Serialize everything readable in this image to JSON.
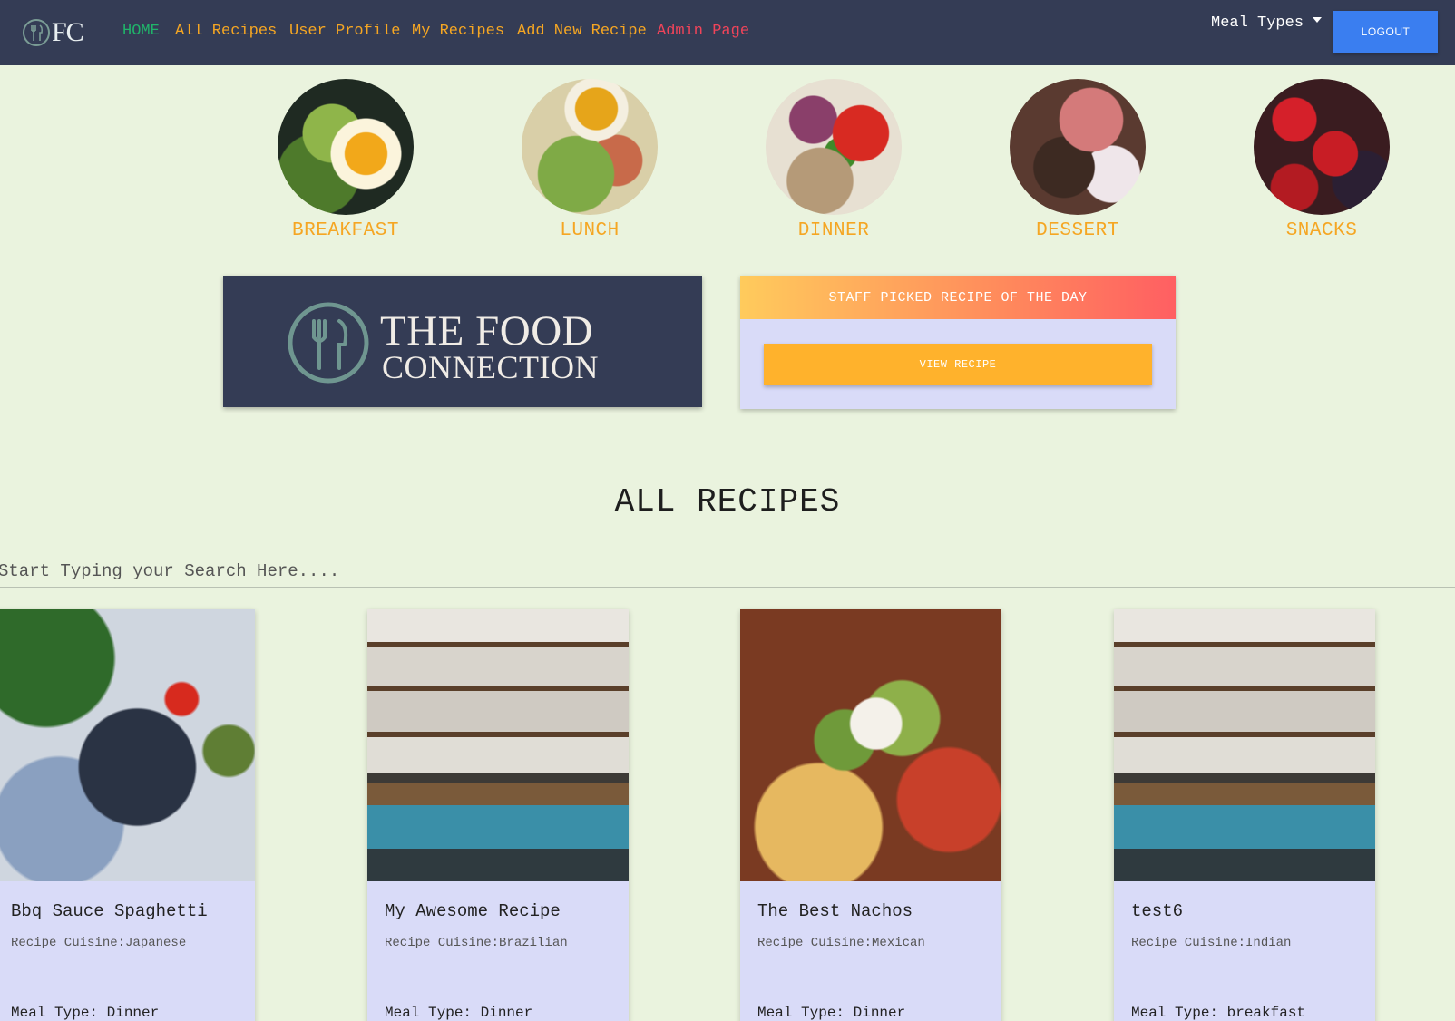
{
  "nav": {
    "brand": "FC",
    "links": [
      "HOME",
      "All Recipes",
      "User Profile",
      "My Recipes",
      "Add New Recipe",
      "Admin Page"
    ],
    "meal_types": "Meal Types",
    "logout": "LOGOUT"
  },
  "meals": [
    "BREAKFAST",
    "LUNCH",
    "DINNER",
    "DESSERT",
    "SNACKS"
  ],
  "banner": {
    "line1": "THE FOOD",
    "line2": "CONNECTION"
  },
  "staff_pick": {
    "title": "STAFF PICKED RECIPE OF THE DAY",
    "button": "VIEW RECIPE"
  },
  "recipes": {
    "title": "ALL RECIPES",
    "search_placeholder": "Start Typing your Search Here....",
    "cards": [
      {
        "title": "Bbq Sauce Spaghetti",
        "cuisine": "Recipe Cuisine:Japanese",
        "meal": "Meal Type: Dinner"
      },
      {
        "title": "My Awesome Recipe",
        "cuisine": "Recipe Cuisine:Brazilian",
        "meal": "Meal Type: Dinner"
      },
      {
        "title": "The Best Nachos",
        "cuisine": "Recipe Cuisine:Mexican",
        "meal": "Meal Type: Dinner"
      },
      {
        "title": "test6",
        "cuisine": "Recipe Cuisine:Indian",
        "meal": "Meal Type: breakfast"
      }
    ]
  },
  "colors": {
    "nav_bg": "#343c55",
    "page_bg": "#eaf3de",
    "accent": "#f5a623",
    "home": "#20b46a",
    "admin": "#f0445a",
    "logout": "#3a7ef0",
    "card_bg": "#d9dbf8"
  }
}
